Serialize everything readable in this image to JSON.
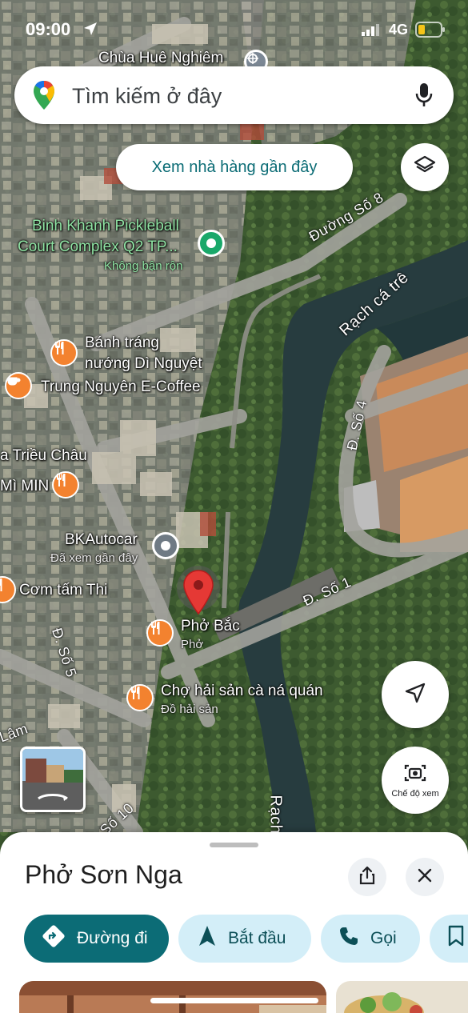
{
  "status_bar": {
    "time": "09:00",
    "network": "4G"
  },
  "search": {
    "placeholder": "Tìm kiếm ở đây"
  },
  "suggestion_chip": {
    "label": "Xem nhà hàng gần đây"
  },
  "map": {
    "labels": {
      "temple": "Chùa Huê Nghiêm",
      "pickleball_line1": "Binh Khanh Pickleball",
      "pickleball_line2": "Court Complex Q2 TP...",
      "pickleball_status": "Không bận rộn",
      "banh_trang_line1": "Bánh tráng",
      "banh_trang_line2": "nướng Dì Nguyệt",
      "coffee": "Trung Nguyên E-Coffee",
      "trieu_chau": "a Triều Châu",
      "mi_min": "Mì MIN",
      "bkautocar": "BKAutocar",
      "bkautocar_sub": "Đã xem gần đây",
      "com_tam": "Cơm tấm Thi",
      "pho_bac": "Phở Bắc",
      "pho_bac_sub": "Phở",
      "cho_hai_san": "Chợ hải sản cà ná quán",
      "cho_hai_san_sub": "Đồ hải sản"
    },
    "streets": {
      "duong_so_8": "Đường Số 8",
      "rach_ca_tre": "Rạch cá trê",
      "d_so_4": "Đ. Số 4",
      "d_so_1": "Đ. Số 1",
      "d_so_5": "Đ. Số 5",
      "d_so_10": "Số 10",
      "lam": "Lâm",
      "rach": "Rạch"
    }
  },
  "view_mode": {
    "label": "Chế độ xem"
  },
  "sheet": {
    "place_name": "Phở Sơn Nga",
    "actions": {
      "directions": "Đường đi",
      "start": "Bắt đầu",
      "call": "Gọi"
    }
  },
  "colors": {
    "accent": "#0c6c76",
    "poi_food": "#f3822f",
    "pin_red": "#e53935"
  }
}
